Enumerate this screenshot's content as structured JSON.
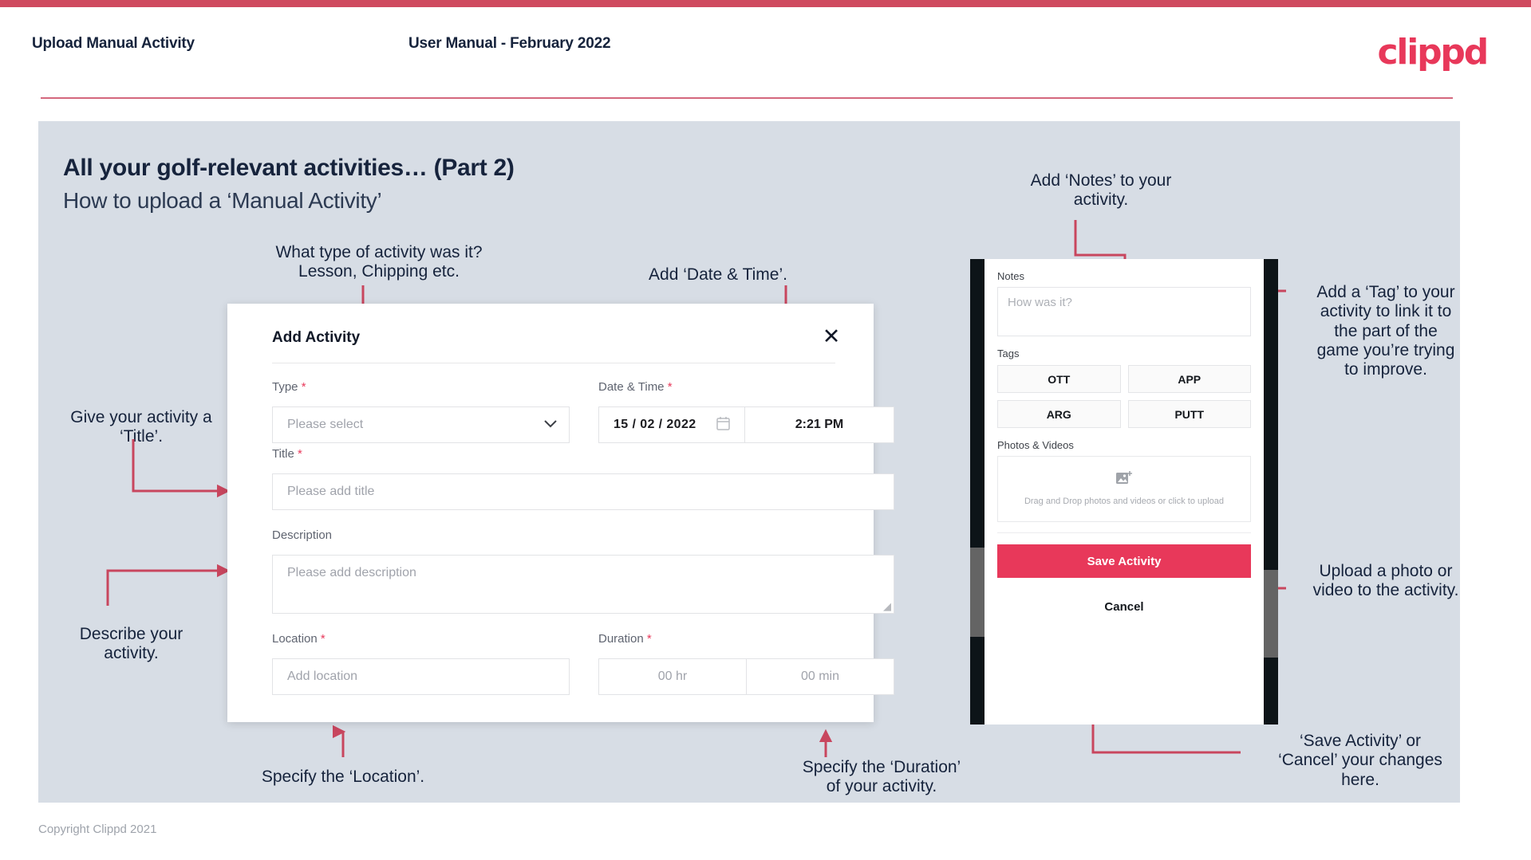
{
  "header": {
    "title": "Upload Manual Activity",
    "subtitle": "User Manual - February 2022",
    "logo": "clippd"
  },
  "slide": {
    "heading": "All your golf-relevant activities… (Part 2)",
    "subheading": "How to upload a ‘Manual Activity’"
  },
  "annotations": {
    "type": "What type of activity was it?\nLesson, Chipping etc.",
    "datetime": "Add ‘Date & Time’.",
    "title": "Give your activity a\n‘Title’.",
    "description": "Describe your\nactivity.",
    "location": "Specify the ‘Location’.",
    "duration": "Specify the ‘Duration’\nof your activity.",
    "notes": "Add ‘Notes’ to your\nactivity.",
    "tags": "Add a ‘Tag’ to your\nactivity to link it to\nthe part of the\ngame you’re trying\nto improve.",
    "upload": "Upload a photo or\nvideo to the activity.",
    "save": "‘Save Activity’ or\n‘Cancel’ your changes\nhere."
  },
  "dialog": {
    "title": "Add Activity",
    "close_icon": "close-icon",
    "fields": {
      "type": {
        "label": "Type",
        "required": "*",
        "placeholder": "Please select"
      },
      "datetime": {
        "label": "Date & Time",
        "required": "*",
        "day": "15",
        "sep1": "/",
        "month": "02",
        "sep2": "/",
        "year": "2022",
        "time": "2:21 PM"
      },
      "title": {
        "label": "Title",
        "required": "*",
        "placeholder": "Please add title"
      },
      "description": {
        "label": "Description",
        "placeholder": "Please add description"
      },
      "location": {
        "label": "Location",
        "required": "*",
        "placeholder": "Add location"
      },
      "duration": {
        "label": "Duration",
        "required": "*",
        "hours": "00 hr",
        "minutes": "00 min"
      }
    }
  },
  "phone": {
    "notes_label": "Notes",
    "notes_placeholder": "How was it?",
    "tags_label": "Tags",
    "tags": [
      "OTT",
      "APP",
      "ARG",
      "PUTT"
    ],
    "photos_label": "Photos & Videos",
    "drop_text": "Drag and Drop photos and videos or click to upload",
    "save_label": "Save Activity",
    "cancel_label": "Cancel"
  },
  "footer": {
    "copyright": "Copyright Clippd 2021"
  },
  "colors": {
    "accent": "#e8385a",
    "arrow": "#c8465e",
    "slide_bg": "#d7dde5",
    "ink": "#16233c"
  }
}
